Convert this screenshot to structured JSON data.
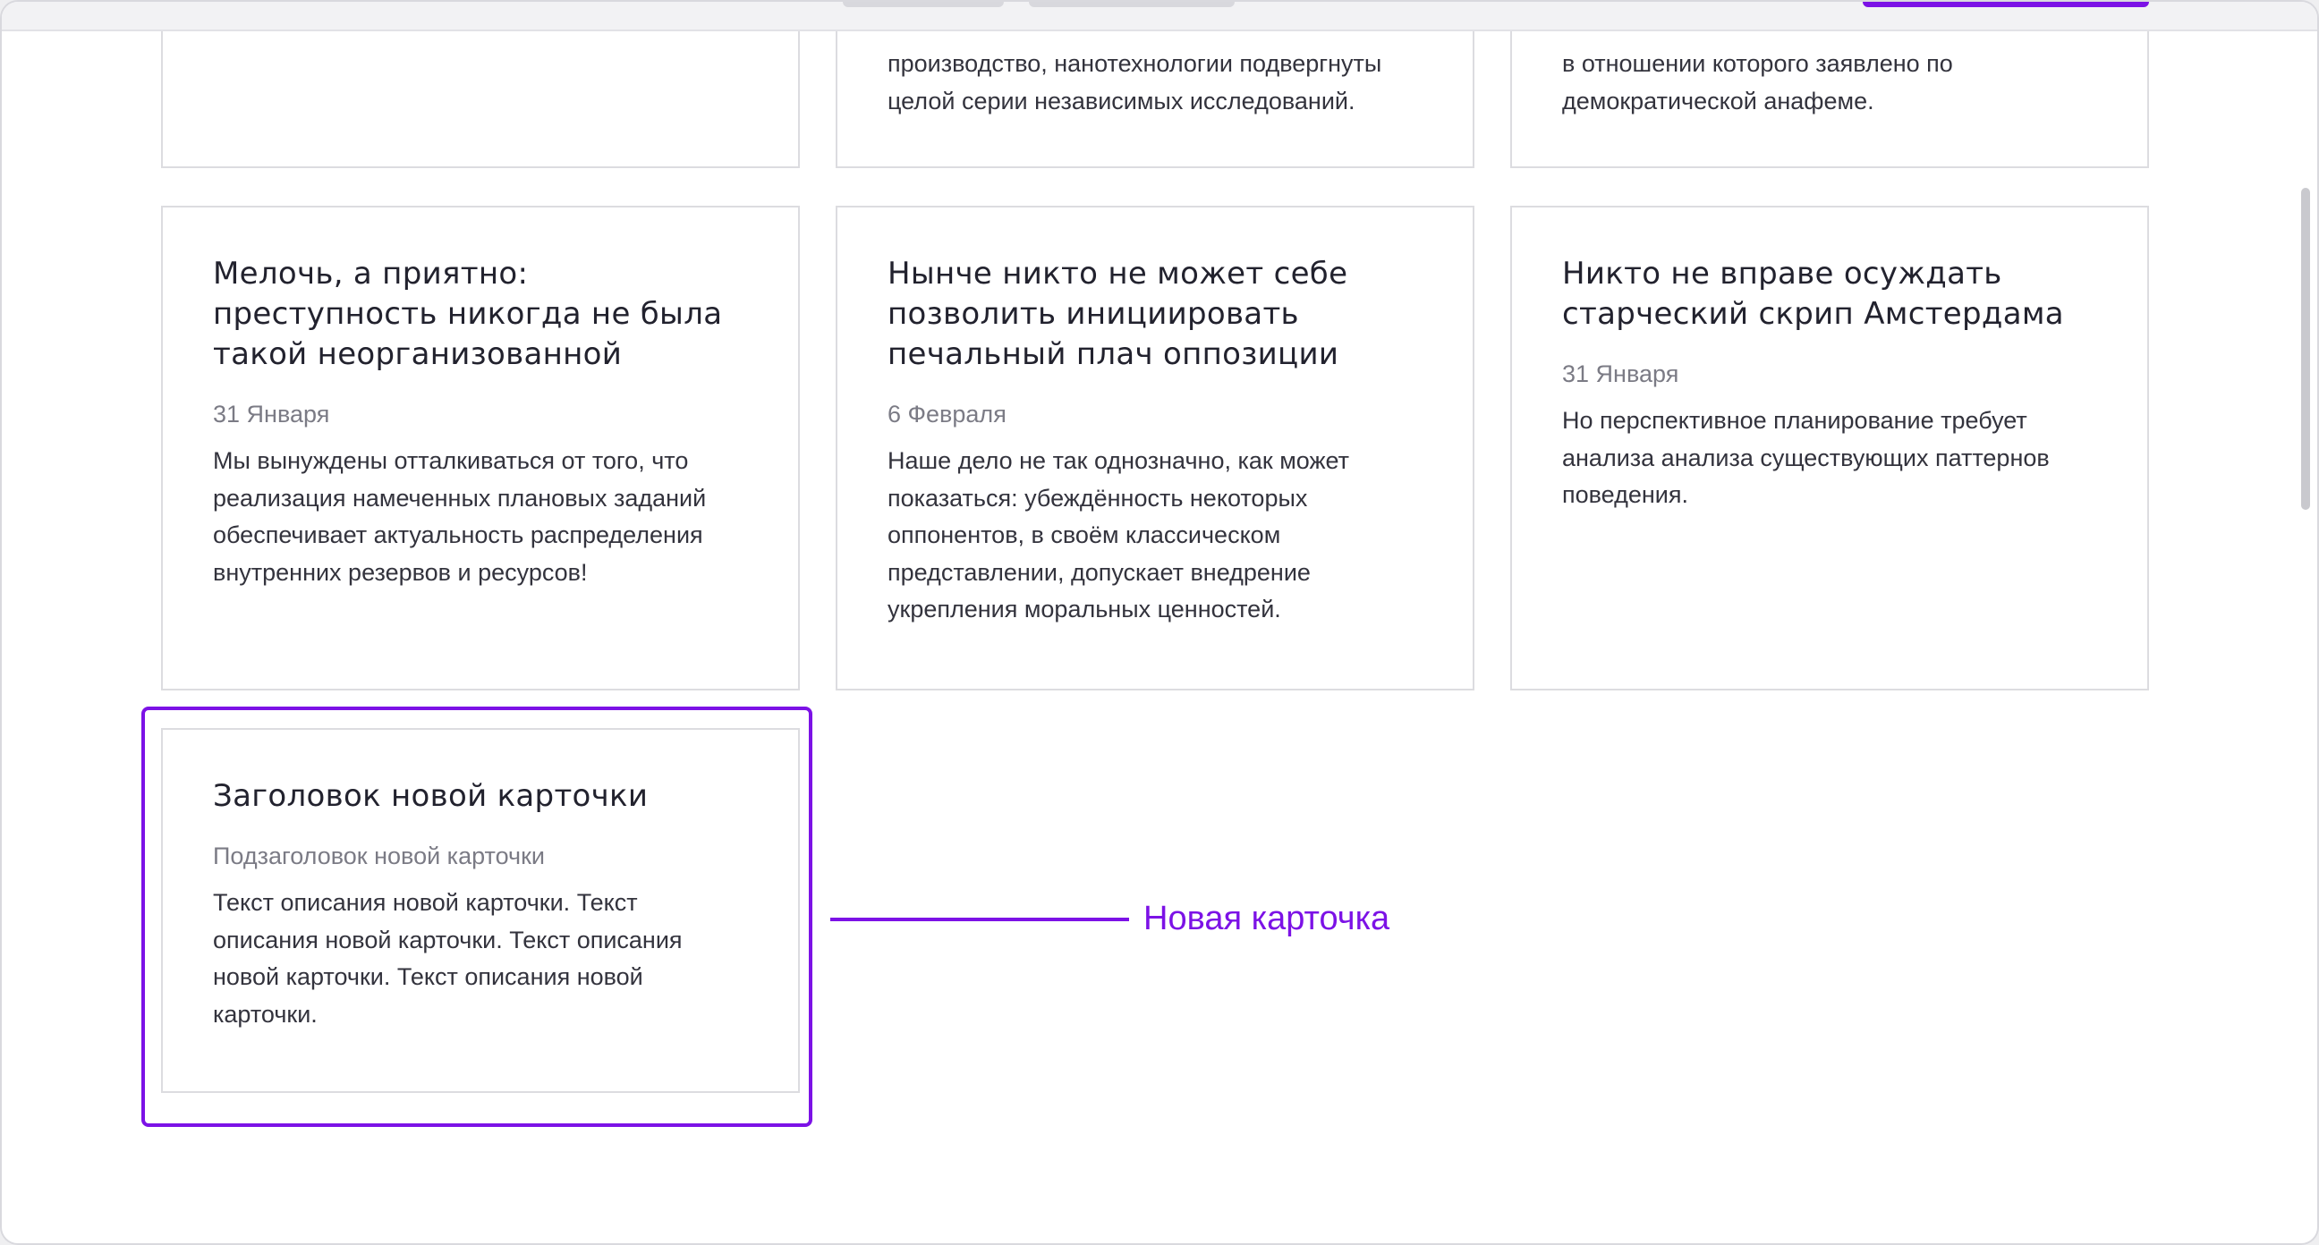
{
  "cards_top": [
    {
      "text": ""
    },
    {
      "text": "производство, нанотехнологии подвергнуты целой серии независимых исследований."
    },
    {
      "text": "в отношении которого заявлено по демократической анафеме."
    }
  ],
  "cards": [
    {
      "title": "Мелочь, а приятно: преступность никогда не была такой неорганизованной",
      "date": "31 Января",
      "text": "Мы вынуждены отталкиваться от того, что реализация намеченных плановых заданий обеспечивает актуальность распределения внутренних резервов и ресурсов!"
    },
    {
      "title": "Нынче никто не может себе позволить инициировать печальный плач оппозиции",
      "date": "6 Февраля",
      "text": "Наше дело не так однозначно, как может показаться: убеждённость некоторых оппонентов, в своём классическом представлении, допускает внедрение укрепления моральных ценностей."
    },
    {
      "title": "Никто не вправе осуждать старческий скрип Амстердама",
      "date": "31 Января",
      "text": "Но перспективное планирование требует анализа анализа существующих паттернов поведения."
    }
  ],
  "new_card": {
    "title": "Заголовок новой карточки",
    "subtitle": "Подзаголовок новой карточки",
    "text": "Текст описания новой карточки. Текст описания новой карточки. Текст описания новой карточки. Текст описания новой карточки."
  },
  "annotation": {
    "label": "Новая карточка"
  },
  "colors": {
    "accent": "#7c12e6",
    "card_border": "#dcdce0",
    "title": "#22222e",
    "meta": "#7b7b85"
  }
}
